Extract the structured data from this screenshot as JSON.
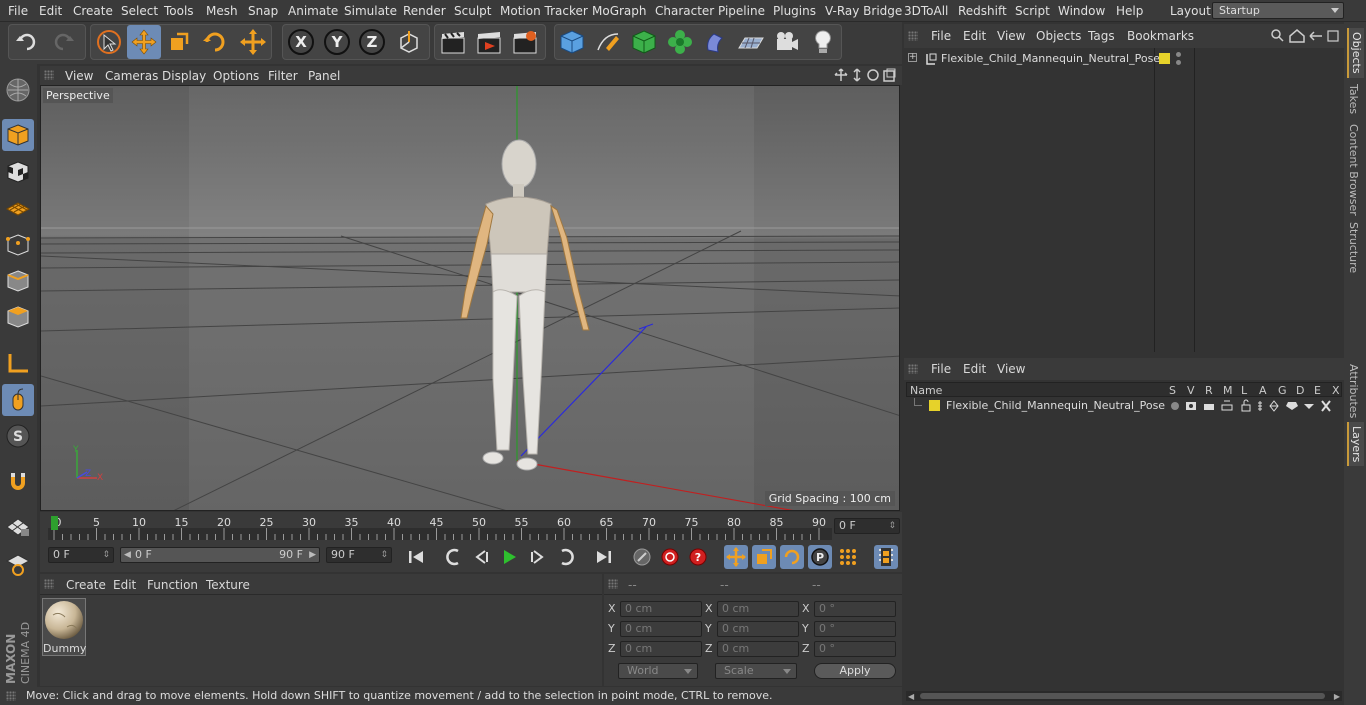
{
  "menubar": {
    "items": [
      "File",
      "Edit",
      "Create",
      "Select",
      "Tools",
      "Mesh",
      "Snap",
      "Animate",
      "Simulate",
      "Render",
      "Sculpt",
      "Motion Tracker",
      "MoGraph",
      "Character",
      "Pipeline",
      "Plugins",
      "V-Ray Bridge",
      "3DToAll",
      "Redshift",
      "Script",
      "Window",
      "Help"
    ],
    "layout_label": "Layout:",
    "layout_value": "Startup"
  },
  "toolbar": {
    "axis_x": "X",
    "axis_y": "Y",
    "axis_z": "Z"
  },
  "viewport": {
    "menu": [
      "View",
      "Cameras",
      "Display",
      "Options",
      "Filter",
      "Panel"
    ],
    "camera_label": "Perspective",
    "grid_spacing": "Grid Spacing : 100 cm"
  },
  "timeline": {
    "ticks": [
      "0",
      "5",
      "10",
      "15",
      "20",
      "25",
      "30",
      "35",
      "40",
      "45",
      "50",
      "55",
      "60",
      "65",
      "70",
      "75",
      "80",
      "85",
      "90"
    ],
    "current_frame": "0 F"
  },
  "transport": {
    "start_field": "0 F",
    "range_min": "0 F",
    "range_max": "90 F",
    "end_field": "90 F"
  },
  "material_panel": {
    "menu": [
      "Create",
      "Edit",
      "Function",
      "Texture"
    ],
    "material_name": "Dummy"
  },
  "attributes": {
    "headers": [
      "--",
      "--",
      "--"
    ],
    "rows": [
      {
        "a": "X",
        "v1": "0 cm",
        "b": "X",
        "v2": "0 cm",
        "c": "X",
        "v3": "0 °"
      },
      {
        "a": "Y",
        "v1": "0 cm",
        "b": "Y",
        "v2": "0 cm",
        "c": "Y",
        "v3": "0 °"
      },
      {
        "a": "Z",
        "v1": "0 cm",
        "b": "Z",
        "v2": "0 cm",
        "c": "Z",
        "v3": "0 °"
      }
    ],
    "coord_mode": "World",
    "size_mode": "Scale",
    "apply_label": "Apply"
  },
  "object_manager": {
    "menu": [
      "File",
      "Edit",
      "View",
      "Objects",
      "Tags",
      "Bookmarks"
    ],
    "object_name": "Flexible_Child_Mannequin_Neutral_Pose"
  },
  "layer_manager": {
    "menu": [
      "File",
      "Edit",
      "View"
    ],
    "col_name": "Name",
    "cols": [
      "S",
      "V",
      "R",
      "M",
      "L",
      "A",
      "G",
      "D",
      "E",
      "X"
    ],
    "layer_name": "Flexible_Child_Mannequin_Neutral_Pose"
  },
  "right_tabs": {
    "top": [
      "Objects",
      "Takes",
      "Content Browser",
      "Structure"
    ],
    "bottom": [
      "Attributes",
      "Layers"
    ]
  },
  "status": "Move: Click and drag to move elements. Hold down SHIFT to quantize movement / add to the selection in point mode, CTRL to remove.",
  "branding": {
    "maxon": "MAXON",
    "cinema": "CINEMA 4D"
  },
  "colors": {
    "accent": "#6d8bb5",
    "layer_color": "#e6d22a"
  }
}
